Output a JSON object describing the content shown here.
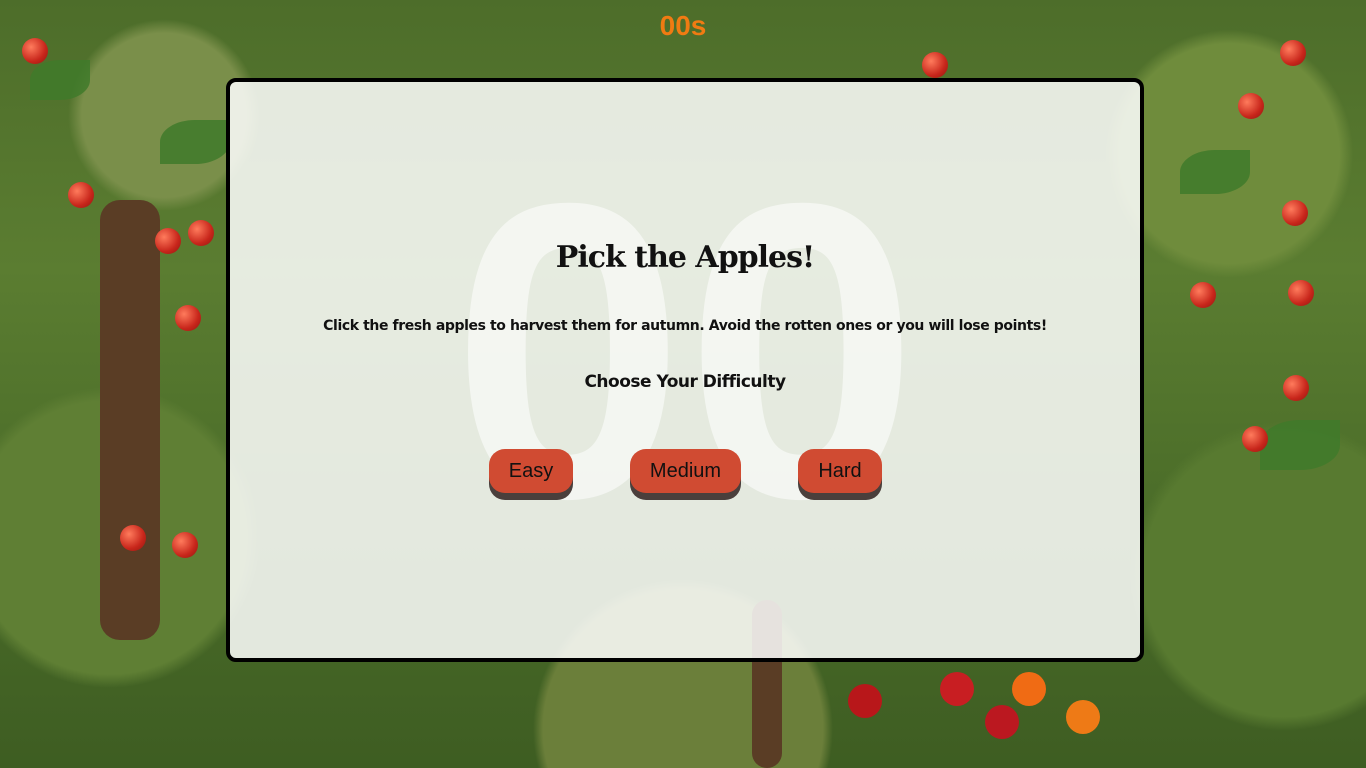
{
  "timer": {
    "value": "00s",
    "color": "#f07b12"
  },
  "panel": {
    "ghost_text": "00",
    "title": "Pick the Apples!",
    "description": "Click the fresh apples to harvest them for autumn. Avoid the rotten ones or you will lose points!",
    "difficulty_heading": "Choose Your Difficulty",
    "buttons": {
      "easy": "Easy",
      "medium": "Medium",
      "hard": "Hard"
    },
    "button_color": "#d04b32"
  }
}
